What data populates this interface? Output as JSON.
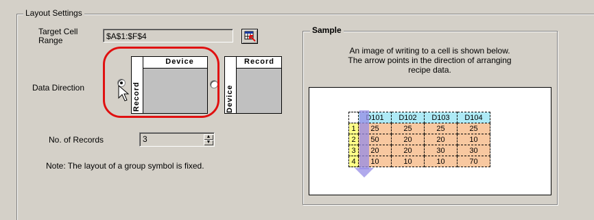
{
  "group_title": "Layout Settings",
  "target_cell": {
    "label": "Target Cell\nRange",
    "value": "$A$1:$F$4"
  },
  "direction": {
    "label": "Data Direction",
    "option1": {
      "top": "Device",
      "left": "Record",
      "selected": true
    },
    "option2": {
      "top": "Record",
      "left": "Device",
      "selected": false
    }
  },
  "records": {
    "label": "No. of Records",
    "value": "3"
  },
  "note": "Note: The layout of a group symbol is fixed.",
  "sample": {
    "title": "Sample",
    "description": "An image of writing to a cell is shown below.\nThe arrow points in the direction of arranging\nrecipe data.",
    "columns": [
      "D101",
      "D102",
      "D103",
      "D104"
    ],
    "rows": [
      {
        "num": "1",
        "cells": [
          "25",
          "25",
          "25",
          "25"
        ]
      },
      {
        "num": "2",
        "cells": [
          "50",
          "20",
          "20",
          "10"
        ]
      },
      {
        "num": "3",
        "cells": [
          "20",
          "20",
          "30",
          "30"
        ]
      },
      {
        "num": "4",
        "cells": [
          "10",
          "10",
          "10",
          "70"
        ]
      }
    ]
  },
  "colors": {
    "highlight": "#e01010",
    "header_row": "#aeeaf6",
    "header_col": "#ffff88",
    "cells": "#f8c8a0",
    "arrow": "#968ce6"
  }
}
